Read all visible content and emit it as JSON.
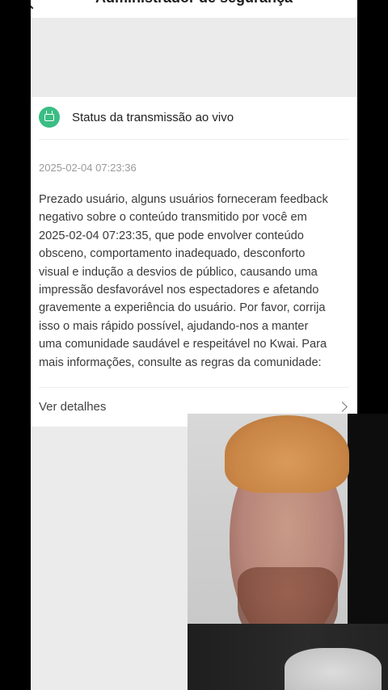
{
  "header": {
    "title": "Administrador de segurança"
  },
  "notification": {
    "title": "Status da transmissão ao vivo",
    "icon": "tv-icon",
    "icon_color": "#3bbd84",
    "timestamp": "2025-02-04 07:23:36",
    "message_lines": [
      "Prezado usuário, alguns usuários forneceram feedback",
      "negativo sobre o conteúdo transmitido por você em",
      "2025-02-04 07:23:35, que pode envolver conteúdo",
      "obsceno, comportamento inadequado, desconforto",
      "visual e indução a desvios de público, causando uma",
      "impressão desfavorável nos espectadores e afetando",
      "gravemente a experiência do usuário. Por favor, corrija",
      "isso o mais rápido possível, ajudando-nos a manter",
      "uma comunidade saudável e respeitável no Kwai. Para",
      "mais informações, consulte as regras da comunidade:"
    ],
    "details_label": "Ver detalhes"
  }
}
